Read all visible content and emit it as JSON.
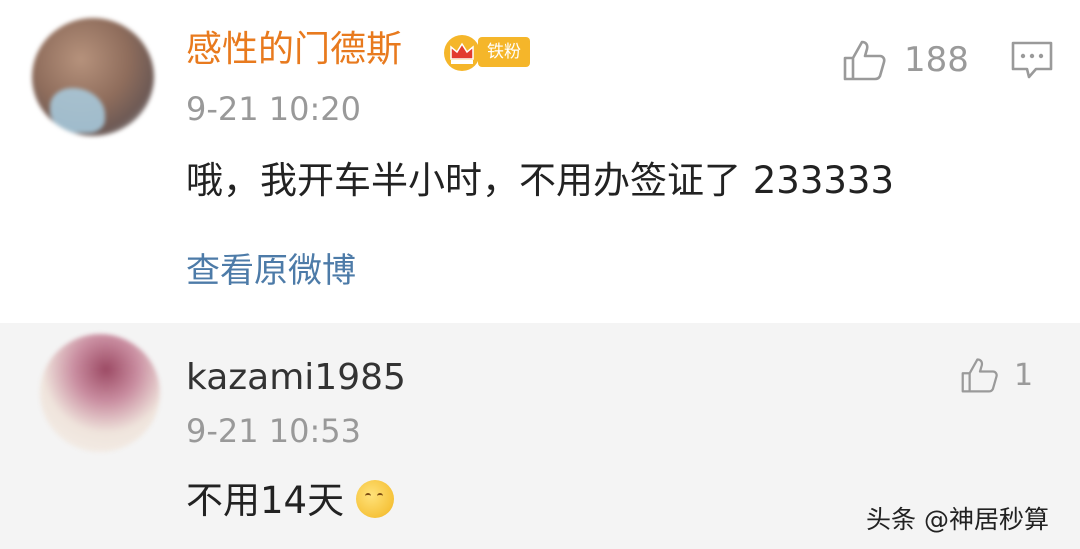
{
  "comments": [
    {
      "username": "感性的门德斯",
      "badge": "铁粉",
      "time": "9-21 10:20",
      "text": "哦，我开车半小时，不用办签证了 233333",
      "view_original": "查看原微博",
      "likes": "188"
    },
    {
      "username": "kazami1985",
      "time": "9-21 10:53",
      "text": "不用14天",
      "likes": "1"
    }
  ],
  "watermark": "头条 @神居秒算",
  "icons": {
    "like": "thumbs-up-icon",
    "reply": "comment-icon",
    "badge": "crown-icon",
    "emoji": "shushing-face-emoji"
  },
  "colors": {
    "username_vip": "#e87a1e",
    "link": "#4d7ba8",
    "badge": "#f5b62a",
    "reply_bg": "#f4f4f4"
  }
}
